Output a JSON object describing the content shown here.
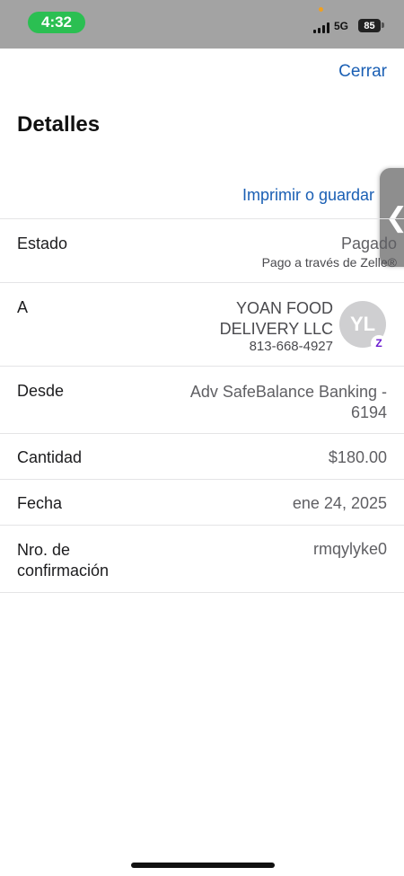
{
  "status_bar": {
    "time": "4:32",
    "network": "5G",
    "battery": "85",
    "time_pill_color": "#2bbf52"
  },
  "header": {
    "close_label": "Cerrar",
    "title": "Detalles",
    "print_label": "Imprimir o guardar"
  },
  "rows": {
    "status": {
      "label": "Estado",
      "value": "Pagado",
      "sub": "Pago a través de Zelle®"
    },
    "to": {
      "label": "A",
      "name_line1": "YOAN FOOD",
      "name_line2": "DELIVERY LLC",
      "phone": "813-668-4927",
      "avatar_initials": "YL",
      "badge_icon": "zelle-icon",
      "badge_glyph": "Z"
    },
    "from": {
      "label": "Desde",
      "value_line1": "Adv SafeBalance Banking -",
      "value_line2": "6194"
    },
    "amount": {
      "label": "Cantidad",
      "value": "$180.00"
    },
    "date": {
      "label": "Fecha",
      "value": "ene 24, 2025"
    },
    "confirmation": {
      "label_line1": "Nro. de",
      "label_line2": "confirmación",
      "value": "rmqylyke0"
    }
  },
  "colors": {
    "link": "#1a5fb4",
    "status_bar_bg": "#a3a3a3",
    "zelle_purple": "#6b1cd0"
  }
}
